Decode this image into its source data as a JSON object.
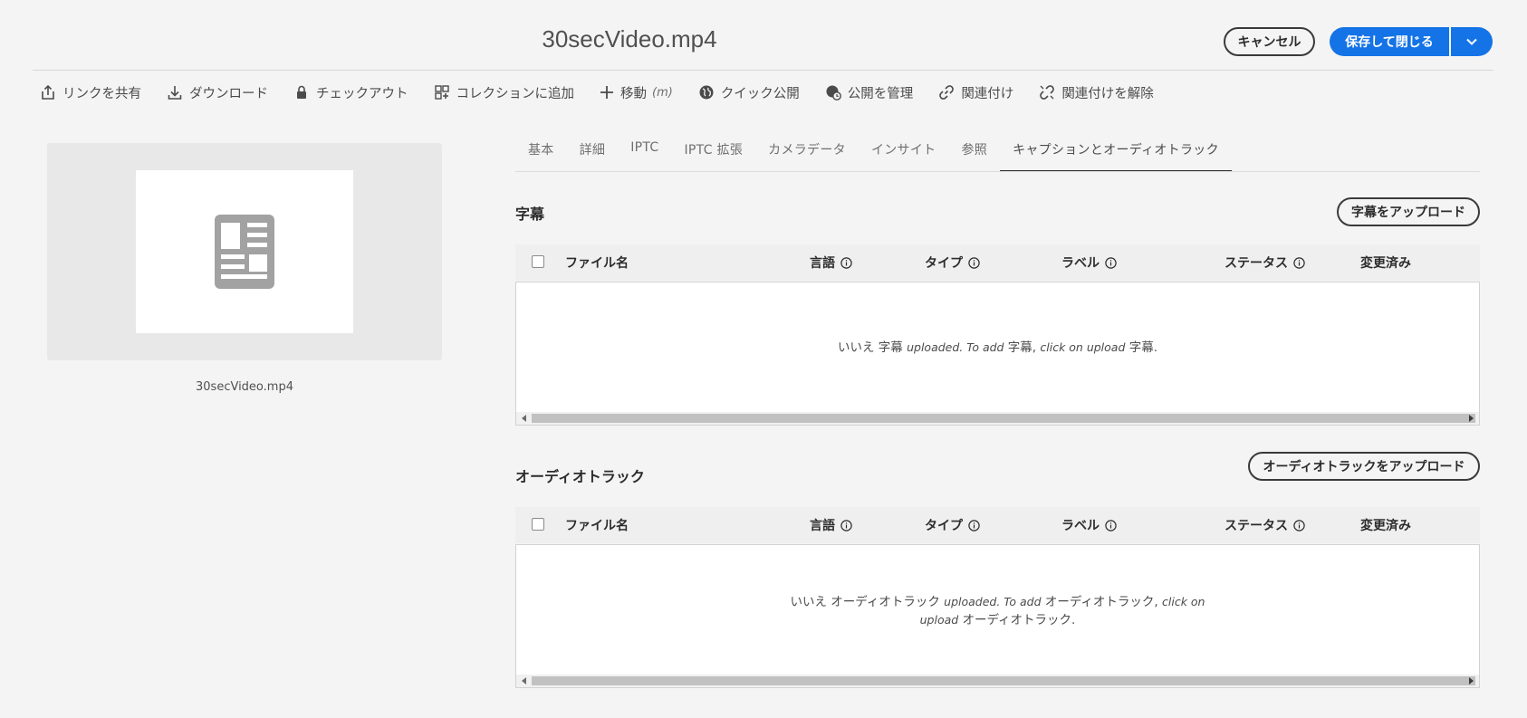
{
  "header": {
    "title": "30secVideo.mp4",
    "cancel_label": "キャンセル",
    "save_label": "保存して閉じる"
  },
  "toolbar": {
    "items": [
      {
        "label": "リンクを共有",
        "icon": "share-icon"
      },
      {
        "label": "ダウンロード",
        "icon": "download-icon"
      },
      {
        "label": "チェックアウト",
        "icon": "lock-icon"
      },
      {
        "label": "コレクションに追加",
        "icon": "add-to-collection-icon"
      },
      {
        "label": "移動",
        "shortcut": "(m)",
        "icon": "move-icon"
      },
      {
        "label": "クイック公開",
        "icon": "globe-icon"
      },
      {
        "label": "公開を管理",
        "icon": "manage-publication-icon"
      },
      {
        "label": "関連付け",
        "icon": "link-icon"
      },
      {
        "label": "関連付けを解除",
        "icon": "unlink-icon"
      }
    ]
  },
  "preview": {
    "file_name": "30secVideo.mp4",
    "icon": "document-icon"
  },
  "tabs": [
    {
      "label": "基本",
      "active": false
    },
    {
      "label": "詳細",
      "active": false
    },
    {
      "label": "IPTC",
      "active": false
    },
    {
      "label": "IPTC 拡張",
      "active": false
    },
    {
      "label": "カメラデータ",
      "active": false
    },
    {
      "label": "インサイト",
      "active": false
    },
    {
      "label": "参照",
      "active": false
    },
    {
      "label": "キャプションとオーディオトラック",
      "active": true
    }
  ],
  "subtitles": {
    "title": "字幕",
    "upload_label": "字幕をアップロード",
    "columns": {
      "filename": "ファイル名",
      "language": "言語",
      "type": "タイプ",
      "label": "ラベル",
      "status": "ステータス",
      "modified": "変更済み"
    },
    "empty_prefix": "いいえ 字幕",
    "empty_mid1": "uploaded. To add",
    "empty_mid2": "字幕,",
    "empty_mid3": "click on upload",
    "empty_suffix": "字幕."
  },
  "audio": {
    "title": "オーディオトラック",
    "upload_label": "オーディオトラックをアップロード",
    "columns": {
      "filename": "ファイル名",
      "language": "言語",
      "type": "タイプ",
      "label": "ラベル",
      "status": "ステータス",
      "modified": "変更済み"
    },
    "empty_prefix": "いいえ オーディオトラック",
    "empty_mid1": "uploaded. To add",
    "empty_mid2": "オーディオトラック,",
    "empty_mid3": "click on upload",
    "empty_suffix": "オーディオトラック."
  },
  "colors": {
    "accent": "#1473e6",
    "background": "#f4f4f4"
  }
}
